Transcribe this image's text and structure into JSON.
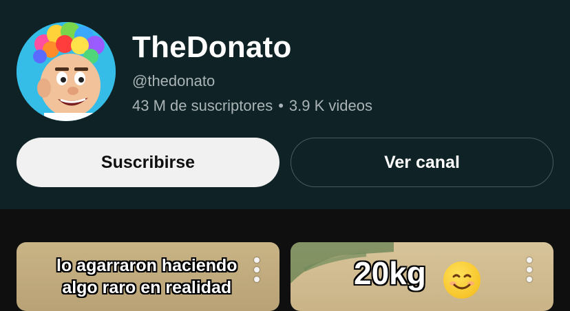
{
  "channel": {
    "name": "TheDonato",
    "handle": "@thedonato",
    "subscribers": "43 M de suscriptores",
    "separator": "•",
    "videos": "3.9 K videos"
  },
  "buttons": {
    "subscribe_label": "Suscribirse",
    "view_channel_label": "Ver canal"
  },
  "videos": [
    {
      "caption_line1": "lo agarraron haciendo",
      "caption_line2": "algo raro en realidad"
    },
    {
      "caption": "20kg"
    }
  ],
  "colors": {
    "header_bg": "#0f2326",
    "page_bg": "#0f0f0f",
    "subscribe_bg": "#f1f1f1",
    "secondary_text": "#aab4b6"
  }
}
